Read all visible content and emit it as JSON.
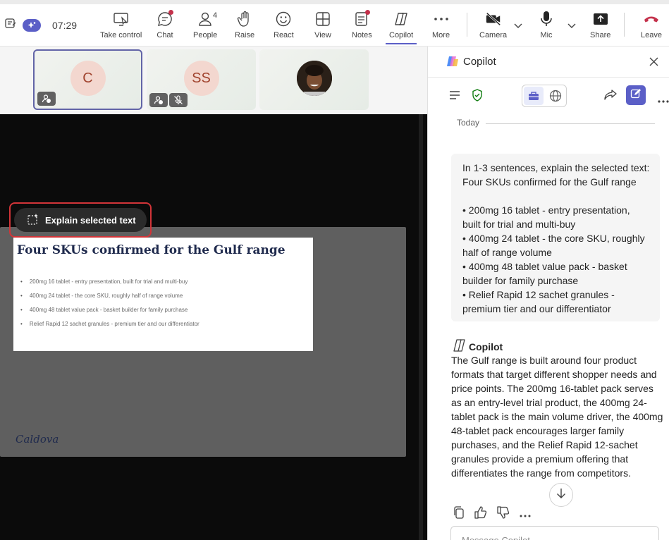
{
  "toolbar": {
    "time": "07:29",
    "buttons": [
      {
        "label": "Take control"
      },
      {
        "label": "Chat"
      },
      {
        "label": "People",
        "count": "4"
      },
      {
        "label": "Raise"
      },
      {
        "label": "React"
      },
      {
        "label": "View"
      },
      {
        "label": "Notes"
      },
      {
        "label": "Copilot"
      },
      {
        "label": "More"
      },
      {
        "label": "Camera"
      },
      {
        "label": "Mic"
      },
      {
        "label": "Share"
      },
      {
        "label": "Leave"
      }
    ],
    "accent": "#5b5fc7",
    "leave_color": "#c4314b"
  },
  "participants": [
    {
      "initials": "C",
      "active": true
    },
    {
      "initials": "SS",
      "active": false
    },
    {
      "initials": "",
      "active": false
    }
  ],
  "stage": {
    "explain_button": "Explain selected text",
    "slide": {
      "title": "Four SKUs confirmed for the Gulf range",
      "bullets": [
        "200mg 16 tablet - entry presentation, built for trial and multi-buy",
        "400mg 24 tablet - the core SKU, roughly half of range volume",
        "400mg 48 tablet value pack - basket builder for family purchase",
        "Relief Rapid 12 sachet granules - premium tier and our differentiator"
      ],
      "logo": "Caldova"
    }
  },
  "copilot": {
    "title": "Copilot",
    "date_divider": "Today",
    "user_message_lines": [
      "In 1-3 sentences, explain the selected text:",
      "Four SKUs confirmed for the Gulf range",
      "",
      "• 200mg 16 tablet - entry presentation,",
      "built for trial and multi-buy",
      "• 400mg 24 tablet - the core SKU, roughly",
      "half of range volume",
      "• 400mg 48 tablet value pack - basket",
      "builder for family purchase",
      "• Relief Rapid 12 sachet granules -",
      "premium tier and our differentiator"
    ],
    "responder": "Copilot",
    "answer": "The Gulf range is built around four product formats that target different shopper needs and price points. The 200mg 16-tablet pack serves as an entry-level trial product, the 400mg 24-tablet pack is the main volume driver, the 400mg 48-tablet pack encourages larger family purchases, and the Relief Rapid 12-sachet granules provide a premium offering that differentiates the range from competitors.",
    "compose_placeholder": "Message Copilot"
  }
}
